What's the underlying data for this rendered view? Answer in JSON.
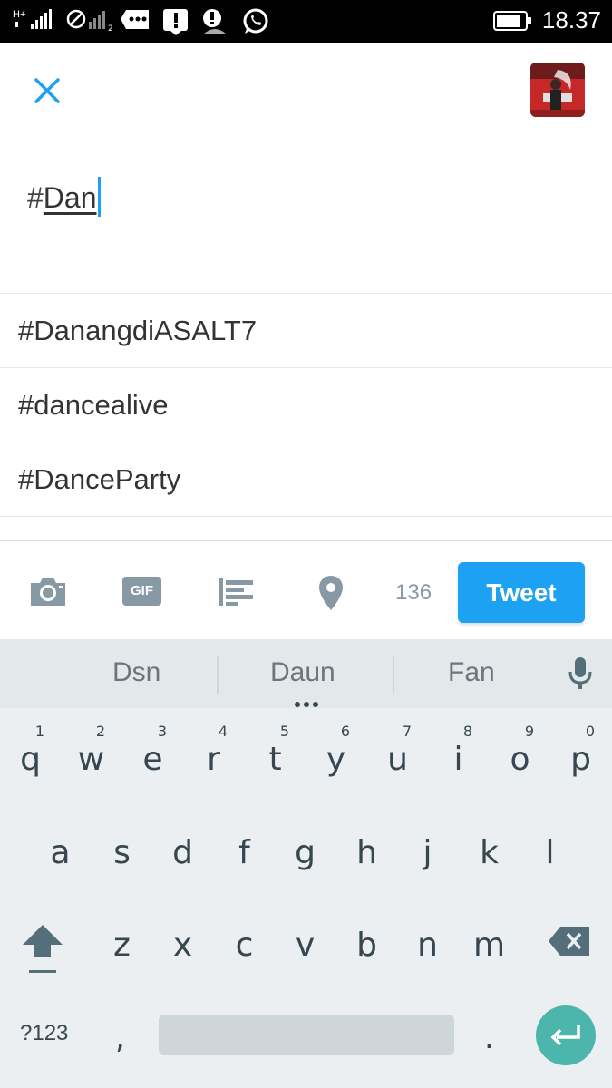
{
  "status_bar": {
    "time": "18.37",
    "network_label": "H+"
  },
  "compose": {
    "hash": "#",
    "typed_word": "Dan"
  },
  "suggestions": [
    "#DanangdiASALT7",
    "#dancealive",
    "#DanceParty"
  ],
  "toolbar": {
    "char_count": "136",
    "tweet_label": "Tweet",
    "gif_label": "GIF"
  },
  "keyboard": {
    "word_suggestions": [
      "Dsn",
      "Daun",
      "Fan"
    ],
    "row1": [
      {
        "ch": "q",
        "num": "1"
      },
      {
        "ch": "w",
        "num": "2"
      },
      {
        "ch": "e",
        "num": "3"
      },
      {
        "ch": "r",
        "num": "4"
      },
      {
        "ch": "t",
        "num": "5"
      },
      {
        "ch": "y",
        "num": "6"
      },
      {
        "ch": "u",
        "num": "7"
      },
      {
        "ch": "i",
        "num": "8"
      },
      {
        "ch": "o",
        "num": "9"
      },
      {
        "ch": "p",
        "num": "0"
      }
    ],
    "row2": [
      "a",
      "s",
      "d",
      "f",
      "g",
      "h",
      "j",
      "k",
      "l"
    ],
    "row3": [
      "z",
      "x",
      "c",
      "v",
      "b",
      "n",
      "m"
    ],
    "symbols_label": "?123",
    "comma": ",",
    "period": "."
  },
  "colors": {
    "accent": "#1da1f2",
    "enter": "#4db6ac",
    "keyboard_bg": "#eceff1"
  }
}
